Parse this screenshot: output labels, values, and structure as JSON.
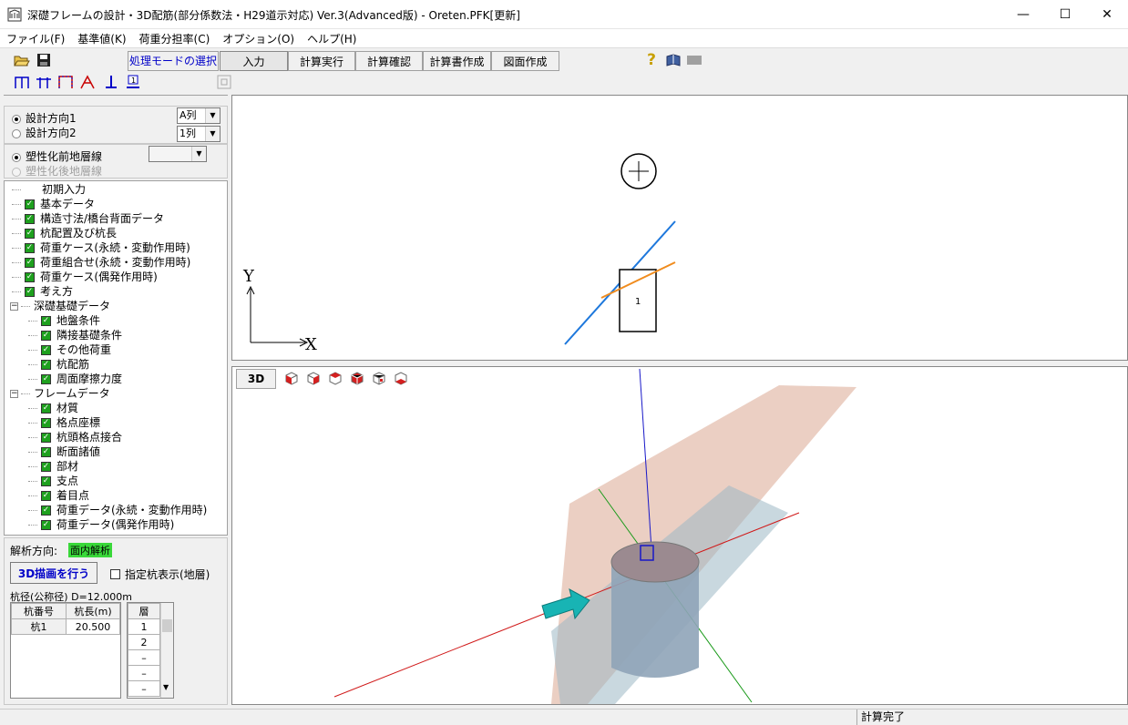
{
  "window": {
    "title": "深礎フレームの設計・3D配筋(部分係数法・H29道示対応) Ver.3(Advanced版) - Oreten.PFK[更新]"
  },
  "menu": [
    "ファイル(F)",
    "基準値(K)",
    "荷重分担率(C)",
    "オプション(O)",
    "ヘルプ(H)"
  ],
  "toolbar": {
    "mode_label": "処理モードの選択",
    "modes": [
      "入力",
      "計算実行",
      "計算確認",
      "計算書作成",
      "図面作成"
    ]
  },
  "direction": {
    "opt1": "設計方向1",
    "opt2": "設計方向2",
    "combo1": "A列",
    "combo2": "1列"
  },
  "layer": {
    "opt1": "塑性化前地層線",
    "opt2": "塑性化後地層線"
  },
  "tree": [
    {
      "label": "初期入力",
      "level": 1,
      "check": false
    },
    {
      "label": "基本データ",
      "level": 1,
      "check": true
    },
    {
      "label": "構造寸法/橋台背面データ",
      "level": 1,
      "check": true
    },
    {
      "label": "杭配置及び杭長",
      "level": 1,
      "check": true
    },
    {
      "label": "荷重ケース(永続・変動作用時)",
      "level": 1,
      "check": true
    },
    {
      "label": "荷重組合せ(永続・変動作用時)",
      "level": 1,
      "check": true
    },
    {
      "label": "荷重ケース(偶発作用時)",
      "level": 1,
      "check": true
    },
    {
      "label": "考え方",
      "level": 1,
      "check": true
    },
    {
      "label": "深礎基礎データ",
      "level": 0,
      "check": false
    },
    {
      "label": "地盤条件",
      "level": 2,
      "check": true
    },
    {
      "label": "隣接基礎条件",
      "level": 2,
      "check": true
    },
    {
      "label": "その他荷重",
      "level": 2,
      "check": true
    },
    {
      "label": "杭配筋",
      "level": 2,
      "check": true
    },
    {
      "label": "周面摩擦力度",
      "level": 2,
      "check": true
    },
    {
      "label": "フレームデータ",
      "level": 0,
      "check": false
    },
    {
      "label": "材質",
      "level": 2,
      "check": true
    },
    {
      "label": "格点座標",
      "level": 2,
      "check": true
    },
    {
      "label": "杭頭格点接合",
      "level": 2,
      "check": true
    },
    {
      "label": "断面諸値",
      "level": 2,
      "check": true
    },
    {
      "label": "部材",
      "level": 2,
      "check": true
    },
    {
      "label": "支点",
      "level": 2,
      "check": true
    },
    {
      "label": "着目点",
      "level": 2,
      "check": true
    },
    {
      "label": "荷重データ(永続・変動作用時)",
      "level": 2,
      "check": true
    },
    {
      "label": "荷重データ(偶発作用時)",
      "level": 2,
      "check": true
    }
  ],
  "analysis": {
    "label": "解析方向:",
    "value": "面内解析",
    "draw3d_button": "3D描画を行う",
    "pile_display": "指定杭表示(地層)",
    "diameter": "杭径(公称径) D=12.000m"
  },
  "pile_table": {
    "headers": [
      "杭番号",
      "杭長(m)"
    ],
    "rows": [
      [
        "杭1",
        "20.500"
      ]
    ]
  },
  "layer_table": {
    "header": "層",
    "rows": [
      "1",
      "2",
      "–",
      "–",
      "–"
    ]
  },
  "view2d": {
    "axis_y": "Y",
    "axis_x": "X",
    "pile_no": "1"
  },
  "view3d": {
    "button": "3D"
  },
  "status": {
    "text": "計算完了"
  },
  "colors": {
    "green_badge": "#39d839",
    "accent_blue": "#0000c8"
  }
}
